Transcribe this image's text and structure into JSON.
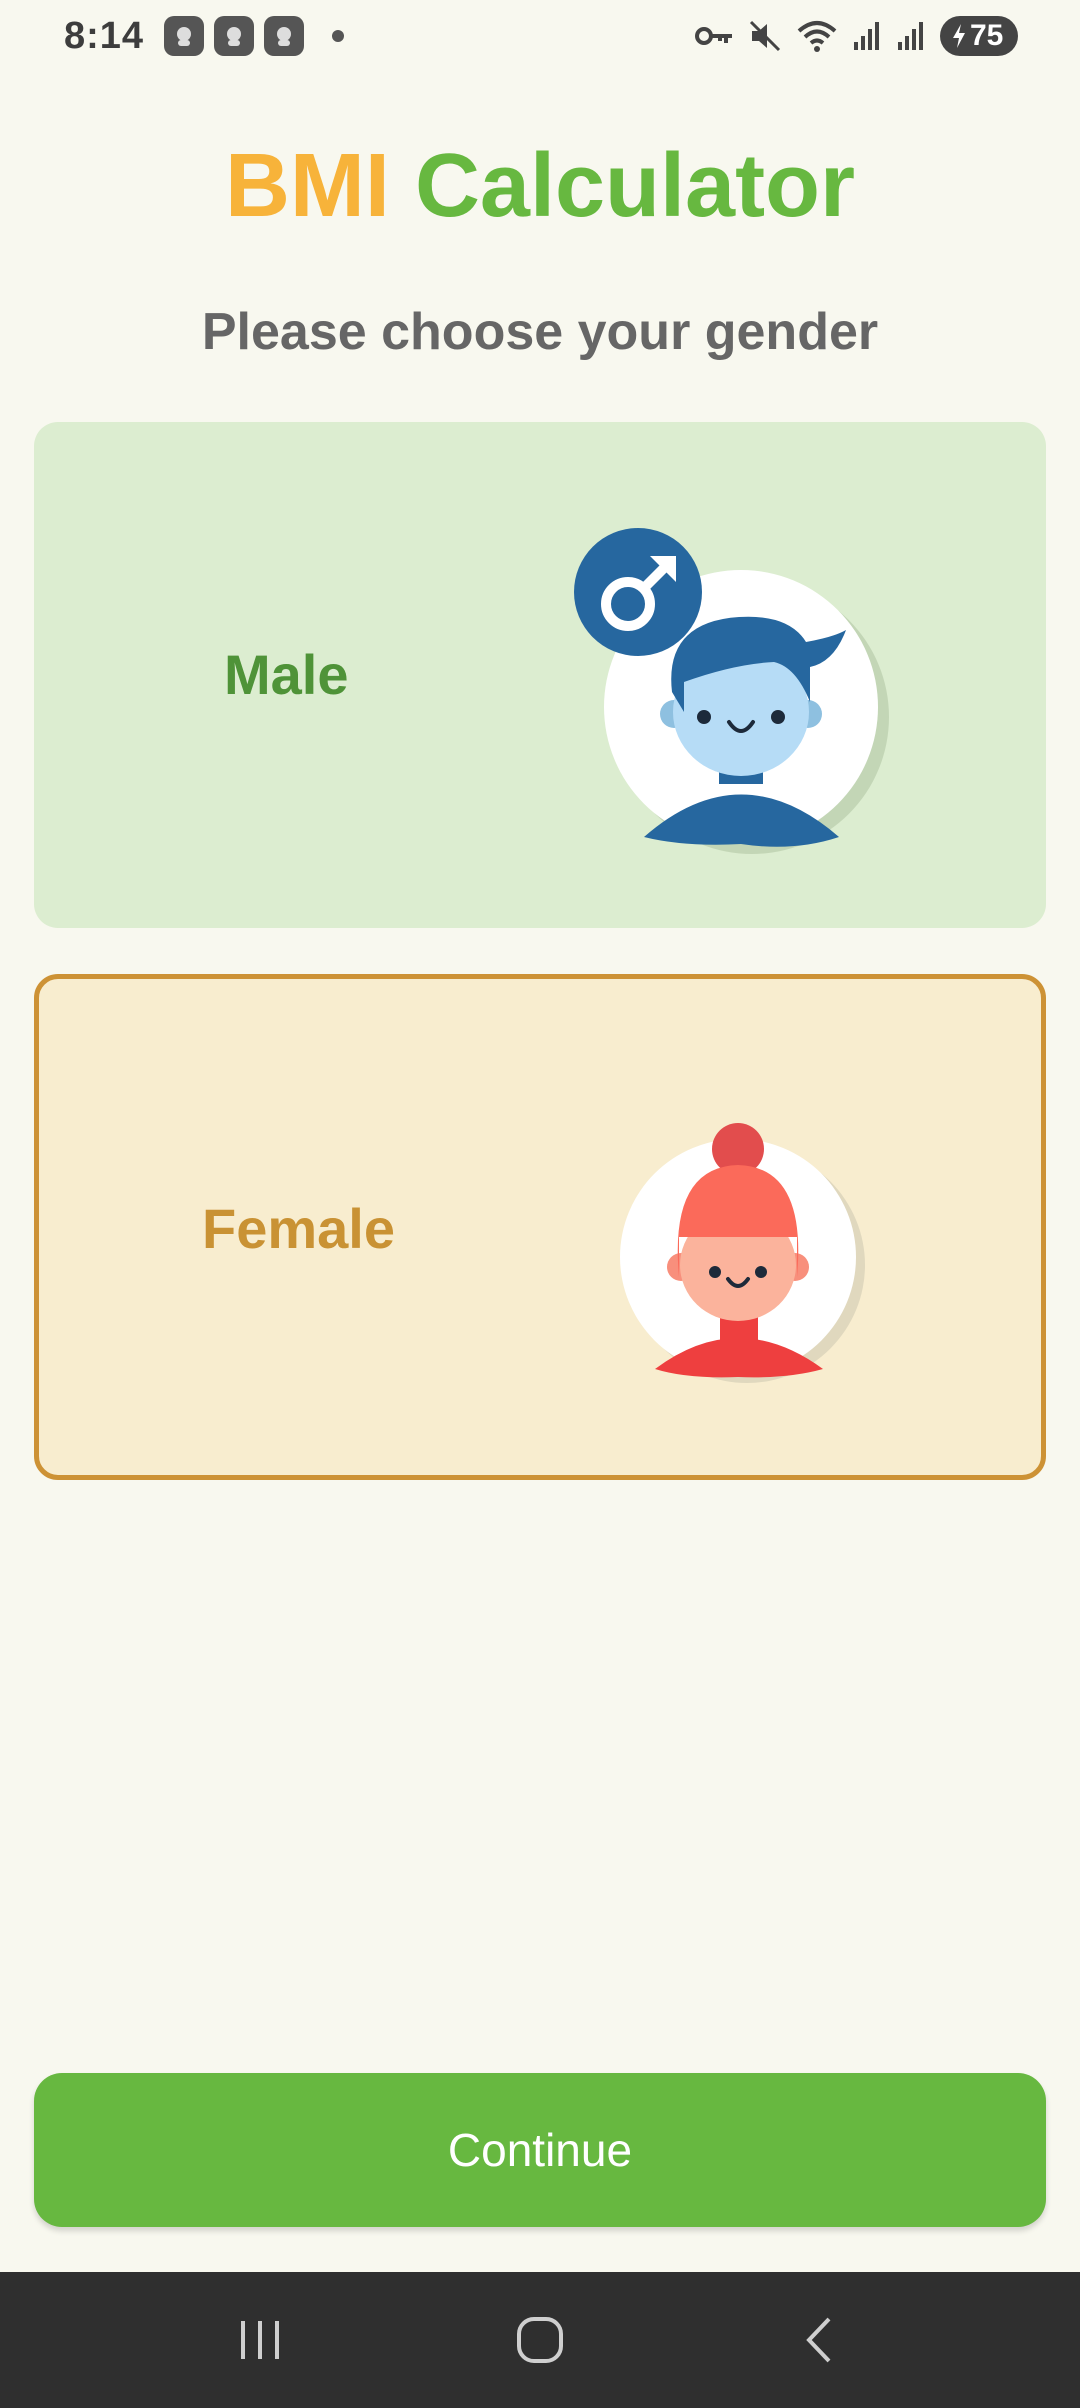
{
  "status_bar": {
    "time": "8:14",
    "battery_level": "75",
    "icons": [
      "notification-app-icon",
      "notification-app-icon",
      "notification-app-icon",
      "key-icon",
      "mute-icon",
      "wifi-icon",
      "signal-icon",
      "signal-icon",
      "battery-charging-icon"
    ]
  },
  "header": {
    "title_part1": "BMI",
    "title_part2": "Calculator",
    "subtitle": "Please choose your gender"
  },
  "options": {
    "male": {
      "label": "Male",
      "icon": "male-symbol-icon"
    },
    "female": {
      "label": "Female"
    }
  },
  "actions": {
    "continue_label": "Continue"
  },
  "colors": {
    "accent_orange": "#f7b33a",
    "accent_green": "#67b840",
    "male_card_bg": "#dcedd0",
    "female_card_bg": "#f8edcf",
    "female_border": "#cd9235"
  },
  "nav_bar": {
    "icons": [
      "recent-apps-icon",
      "home-icon",
      "back-icon"
    ]
  }
}
